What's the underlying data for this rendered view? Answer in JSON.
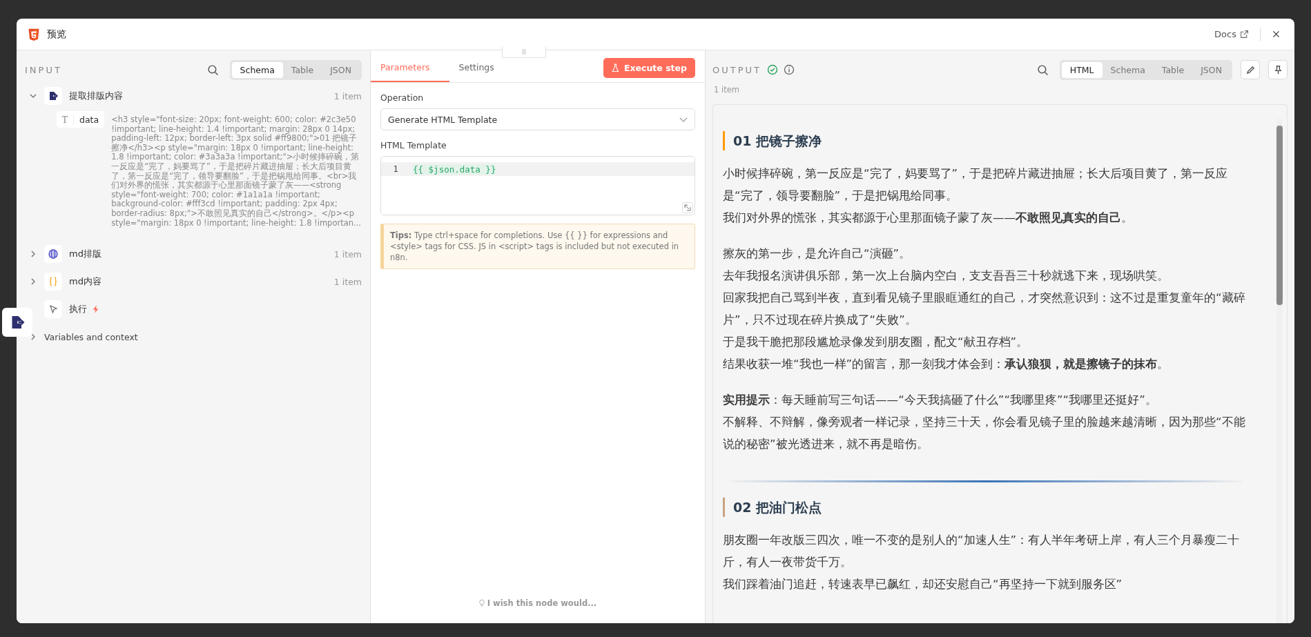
{
  "window": {
    "title": "预览",
    "docs_link": "Docs"
  },
  "input_panel": {
    "heading": "INPUT",
    "tabs": [
      {
        "label": "Schema",
        "selected": true
      },
      {
        "label": "Table",
        "selected": false
      },
      {
        "label": "JSON",
        "selected": false
      }
    ],
    "nodes": [
      {
        "kind": "extract",
        "name": "提取排版内容",
        "count": "1 item",
        "expanded": true,
        "fields": [
          {
            "type_glyph": "T",
            "name": "data",
            "value": "<h3 style=\"font-size: 20px; font-weight: 600; color: #2c3e50 !important; line-height: 1.4 !important; margin: 28px 0 14px; padding-left: 12px; border-left: 3px solid #ff9800;\">01 把镜子擦净</h3><p style=\"margin: 18px 0 !important; line-height: 1.8 !important; color: #3a3a3a !important;\">小时候摔碎碗，第一反应是“完了，妈要骂了”，于是把碎片藏进抽屉；长大后项目黄了，第一反应是“完了，领导要翻脸”，于是把锅甩给同事。<br>我们对外界的慌张，其实都源于心里那面镜子蒙了灰——<strong style=\"font-weight: 700; color: #1a1a1a !important; background-color: #fff3cd !important; padding: 2px 4px; border-radius: 8px;\">不敢照见真实的自己</strong>。</p><p style=\"margin: 18px 0 !important; line-height: 1.8 !importan..."
          }
        ]
      },
      {
        "kind": "globe",
        "name": "md排版",
        "count": "1 item",
        "expanded": false
      },
      {
        "kind": "braces",
        "name": "md内容",
        "count": "1 item",
        "expanded": false
      },
      {
        "kind": "cursor",
        "name": "执行",
        "trigger": true
      }
    ],
    "variables": {
      "label": "Variables and context",
      "expanded": false
    }
  },
  "parameters_panel": {
    "tabs": [
      {
        "label": "Parameters",
        "selected": true
      },
      {
        "label": "Settings",
        "selected": false
      }
    ],
    "execute_button": "Execute step",
    "operation": {
      "label": "Operation",
      "value": "Generate HTML Template"
    },
    "template": {
      "label": "HTML Template",
      "lines": [
        {
          "number": "1",
          "code": "{{ $json.data }}"
        }
      ]
    },
    "tips": "**Tips:** Type ctrl+space for completions. Use {{ }} for expressions and <style> tags for CSS. JS in <script> tags is included but not executed in n8n.",
    "feedback": "I wish this node would..."
  },
  "output_panel": {
    "heading": "OUTPUT",
    "succeeded": true,
    "tabs": [
      {
        "label": "HTML",
        "selected": true
      },
      {
        "label": "Schema",
        "selected": false
      },
      {
        "label": "Table",
        "selected": false
      },
      {
        "label": "JSON",
        "selected": false
      }
    ],
    "count": "1 item",
    "sections": [
      {
        "heading": "01 把镜子擦净",
        "color": "#ff9800",
        "paragraphs": [
          [
            "小时候摔碎碗，第一反应是“完了，妈要骂了”，于是把碎片藏进抽屉；长大后项目黄了，第一反应是“完了，领导要翻脸”，于是把锅甩给同事。",
            "我们对外界的慌张，其实都源于心里那面镜子蒙了灰——**不敢照见真实的自己**。"
          ],
          [
            "擦灰的第一步，是允许自己“演砸”。",
            "去年我报名演讲俱乐部，第一次上台脑内空白，支支吾吾三十秒就逃下来，现场哄笑。",
            "回家我把自己骂到半夜，直到看见镜子里眼眶通红的自己，才突然意识到：这不过是重复童年的“藏碎片”，只不过现在碎片换成了“失败”。",
            "于是我干脆把那段尴尬录像发到朋友圈，配文“献丑存档”。",
            "结果收获一堆“我也一样”的留言，那一刻我才体会到：**承认狼狈，就是擦镜子的抹布**。"
          ],
          [
            "**实用提示**：每天睡前写三句话——“今天我搞砸了什么”“我哪里疼”“我哪里还挺好”。",
            "不解释、不辩解，像旁观者一样记录，坚持三十天，你会看见镜子里的脸越来越清晰，因为那些“不能说的秘密”被光透进来，就不再是暗伤。"
          ]
        ]
      },
      {
        "heading": "02 把油门松点",
        "color": "#c9a27e",
        "paragraphs": [
          [
            "朋友圈一年改版三四次，唯一不变的是别人的“加速人生”：有人半年考研上岸，有人三个月暴瘦二十斤，有人一夜带货千万。",
            "我们踩着油门追赶，转速表早已飙红，却还安慰自己“再坚持一下就到服务区”"
          ]
        ]
      }
    ]
  }
}
